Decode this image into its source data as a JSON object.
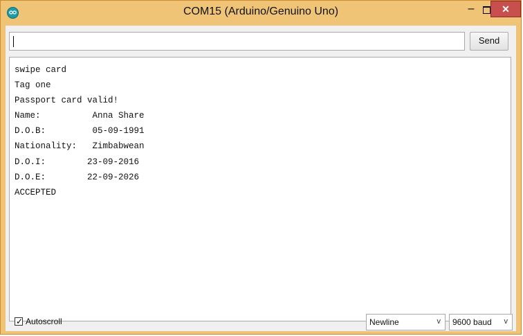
{
  "window": {
    "title": "COM15 (Arduino/Genuino Uno)",
    "minimize_glyph": "–",
    "close_glyph": "✕"
  },
  "toolbar": {
    "input_value": "",
    "send_label": "Send"
  },
  "output": {
    "lines": [
      "swipe card",
      "Tag one",
      "Passport card valid!",
      "Name:          Anna Share",
      "D.O.B:         05-09-1991",
      "Nationality:   Zimbabwean",
      "D.O.I:        23-09-2016",
      "D.O.E:        22-09-2026",
      "ACCEPTED"
    ]
  },
  "status": {
    "autoscroll_label": "Autoscroll",
    "autoscroll_checked": true,
    "line_ending": "Newline",
    "baud_rate": "9600 baud"
  },
  "colors": {
    "titlebar": "#f0c477",
    "close_button": "#c7504f",
    "app_icon": "#1f9aa6"
  },
  "icons": {
    "app": "arduino-infinity-icon",
    "minimize": "minimize-icon",
    "maximize": "maximize-icon",
    "close": "close-icon",
    "dropdown": "chevron-down-icon",
    "check": "checkmark-icon"
  }
}
